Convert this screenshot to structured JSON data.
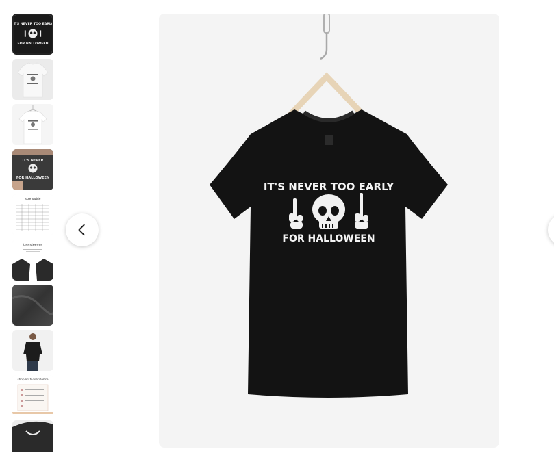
{
  "gallery": {
    "thumbnails": [
      {
        "kind": "black-tee-flat",
        "selected": true
      },
      {
        "kind": "white-tee-flat",
        "selected": false
      },
      {
        "kind": "white-tee-hanger",
        "selected": false
      },
      {
        "kind": "model-closeup",
        "selected": false
      },
      {
        "kind": "size-guide",
        "selected": false,
        "title": "size guide"
      },
      {
        "kind": "sleeves",
        "selected": false,
        "title": "tee sleeves"
      },
      {
        "kind": "fabric",
        "selected": false
      },
      {
        "kind": "model-full",
        "selected": false
      },
      {
        "kind": "confidence",
        "selected": false,
        "title": "shop with confidence"
      },
      {
        "kind": "black-tee-detail",
        "selected": false
      }
    ],
    "prev_icon": "chevron-left-icon",
    "next_icon": "chevron-right-icon"
  },
  "product_image": {
    "design_line1": "IT'S NEVER TOO EARLY",
    "design_line2": "FOR HALLOWEEN",
    "shirt_color": "#111111",
    "print_color": "#f4f4f4",
    "background_color": "#f4f4f4"
  },
  "thumb_size_guide": {
    "title": "size guide"
  },
  "thumb_sleeves": {
    "title": "tee sleeves"
  },
  "thumb_confidence": {
    "title": "shop with confidence"
  }
}
